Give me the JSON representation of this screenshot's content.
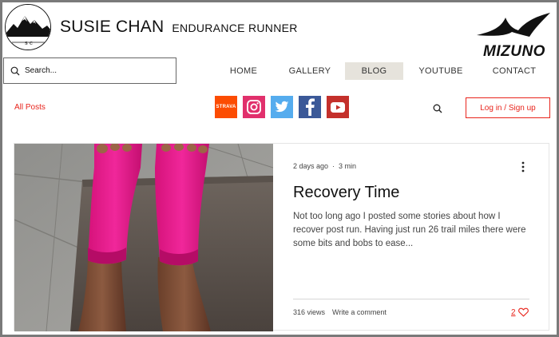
{
  "header": {
    "title": "SUSIE CHAN",
    "subtitle": "ENDURANCE RUNNER",
    "brand_logo_text": "MIZUNO",
    "site_logo_icon": "mountain-logo-icon"
  },
  "search": {
    "placeholder": "Search..."
  },
  "nav": {
    "items": [
      {
        "label": "HOME"
      },
      {
        "label": "GALLERY"
      },
      {
        "label": "BLOG",
        "active": true
      },
      {
        "label": "YOUTUBE"
      },
      {
        "label": "CONTACT"
      }
    ]
  },
  "subbar": {
    "all_posts": "All Posts",
    "social": [
      {
        "name": "strava-icon",
        "label": "STRAVA",
        "color": "#fc4c02"
      },
      {
        "name": "instagram-icon",
        "color": "#e1306c"
      },
      {
        "name": "twitter-icon",
        "color": "#55acee"
      },
      {
        "name": "facebook-icon",
        "color": "#3b5998"
      },
      {
        "name": "youtube-icon",
        "color": "#c4302b"
      }
    ],
    "login_label": "Log in / Sign up"
  },
  "post": {
    "date": "2 days ago",
    "dot": "·",
    "read_time": "3 min",
    "title": "Recovery Time",
    "excerpt": "Not too long ago I posted some stories about how I recover post run. Having just run 26 trail miles there were some bits and bobs to ease...",
    "views": "316 views",
    "comment": "Write a comment",
    "likes": "2"
  },
  "colors": {
    "accent": "#e8241c",
    "active_nav_bg": "#e6e3dc"
  }
}
